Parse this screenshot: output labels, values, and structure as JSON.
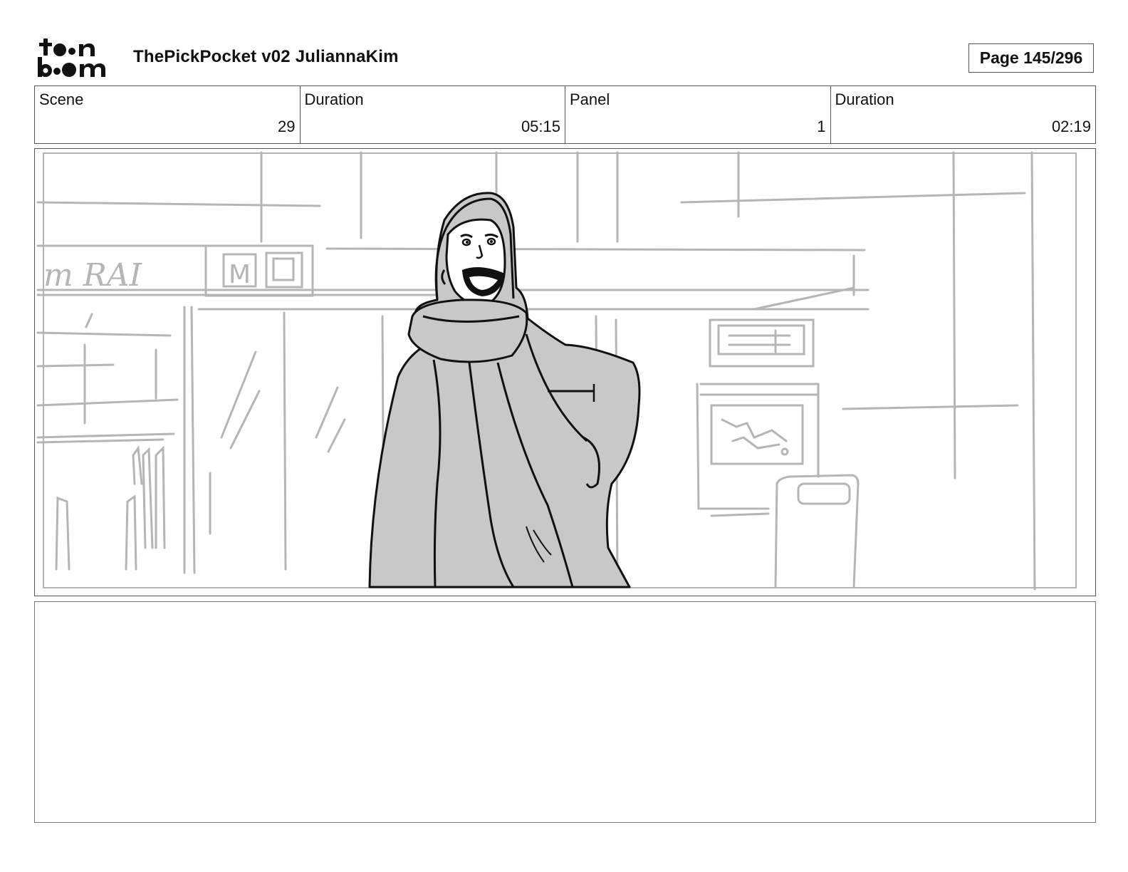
{
  "header": {
    "logo_text": "toon boom",
    "title": "ThePickPocket v02 JuliannaKim",
    "page_label": "Page 145/296"
  },
  "info": {
    "scene_label": "Scene",
    "scene_value": "29",
    "scene_duration_label": "Duration",
    "scene_duration_value": "05:15",
    "panel_label": "Panel",
    "panel_value": "1",
    "panel_duration_label": "Duration",
    "panel_duration_value": "02:19"
  },
  "sketch": {
    "sign_text": "m RAI",
    "sign_letter": "M"
  },
  "notes": {
    "text": ""
  }
}
